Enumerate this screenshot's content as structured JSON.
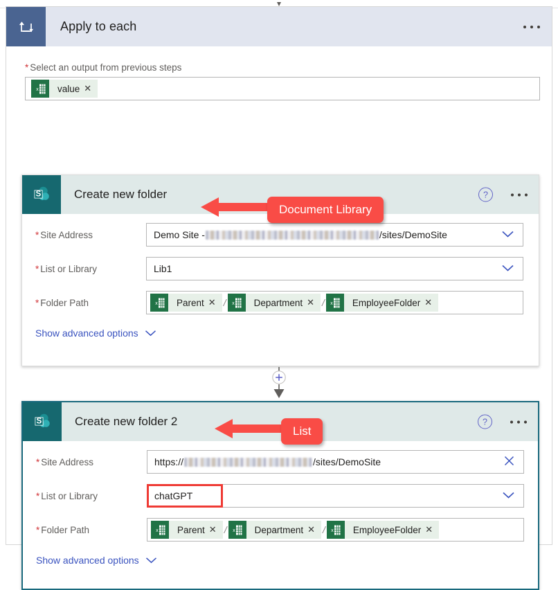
{
  "scope": {
    "title": "Apply to each",
    "icon": "loop-icon",
    "ellipsis": "more-options",
    "output_field": {
      "label": "Select an output from previous steps",
      "required": true,
      "token": {
        "label": "value",
        "icon": "excel-icon",
        "remove": "✕"
      }
    }
  },
  "cards": [
    {
      "id": "create-new-folder",
      "title": "Create new folder",
      "icon": "sharepoint-icon",
      "help": "?",
      "selected": false,
      "rows": [
        {
          "label": "Site Address",
          "required": true,
          "type": "dropdown",
          "value_prefix": "Demo Site - ",
          "value_suffix": "/sites/DemoSite",
          "redacted": true,
          "trailing_icon": "chevron-down-icon"
        },
        {
          "label": "List or Library",
          "required": true,
          "type": "dropdown",
          "value": "Lib1",
          "trailing_icon": "chevron-down-icon",
          "highlighted": false
        },
        {
          "label": "Folder Path",
          "required": true,
          "type": "tokens",
          "tokens": [
            "Parent",
            "Department",
            "EmployeeFolder"
          ],
          "separator": "/"
        }
      ],
      "advanced_label": "Show advanced options"
    },
    {
      "id": "create-new-folder-2",
      "title": "Create new folder 2",
      "icon": "sharepoint-icon",
      "help": "?",
      "selected": true,
      "rows": [
        {
          "label": "Site Address",
          "required": true,
          "type": "text",
          "value_prefix": "https://",
          "value_suffix": "/sites/DemoSite",
          "redacted": true,
          "trailing_icon": "close-icon"
        },
        {
          "label": "List or Library",
          "required": true,
          "type": "dropdown",
          "value": "chatGPT",
          "trailing_icon": "chevron-down-icon",
          "highlighted": true
        },
        {
          "label": "Folder Path",
          "required": true,
          "type": "tokens",
          "tokens": [
            "Parent",
            "Department",
            "EmployeeFolder"
          ],
          "separator": "/"
        }
      ],
      "advanced_label": "Show advanced options"
    }
  ],
  "connector": {
    "add_button": "+",
    "icon": "add-step-icon"
  },
  "callouts": [
    {
      "id": "document-library",
      "text": "Document Library"
    },
    {
      "id": "list",
      "text": "List"
    }
  ],
  "colors": {
    "scope_header_bg": "#e1e5ef",
    "scope_icon_bg": "#4a6491",
    "card_header_bg": "#dfe9e8",
    "sharepoint_teal": "#16686f",
    "selected_border": "#19697d",
    "callout_red": "#f94c46",
    "highlight_red": "#ef3b35",
    "link_blue": "#3a53bf",
    "required_red": "#d13438",
    "excel_green": "#217346",
    "token_bg": "#e7f0e8"
  }
}
